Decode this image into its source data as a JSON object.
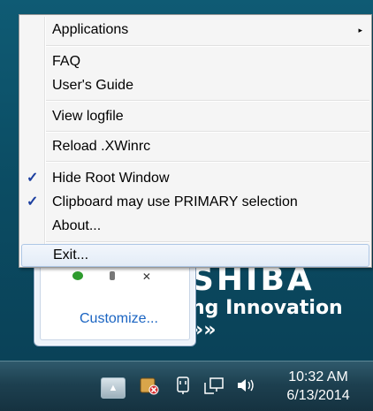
{
  "desktop": {
    "brand": "SHIBA",
    "tagline": "ng Innovation »»"
  },
  "tray_popup": {
    "customize": "Customize..."
  },
  "menu": {
    "items": [
      {
        "label": "Applications",
        "checked": false,
        "submenu": true
      },
      {
        "label": "FAQ"
      },
      {
        "label": "User's Guide"
      },
      {
        "label": "View logfile"
      },
      {
        "label": "Reload .XWinrc"
      },
      {
        "label": "Hide Root Window",
        "checked": true
      },
      {
        "label": "Clipboard may use PRIMARY selection",
        "checked": true
      },
      {
        "label": "About..."
      },
      {
        "label": "Exit...",
        "highlighted": true
      }
    ],
    "check_glyph": "✓",
    "submenu_glyph": "▸"
  },
  "taskbar": {
    "show_hidden_icons_glyph": "▲",
    "clock": {
      "time": "10:32 AM",
      "date": "6/13/2014"
    },
    "icons": [
      "xwin-server-icon",
      "power-plug-icon",
      "network-icon",
      "volume-icon"
    ]
  }
}
